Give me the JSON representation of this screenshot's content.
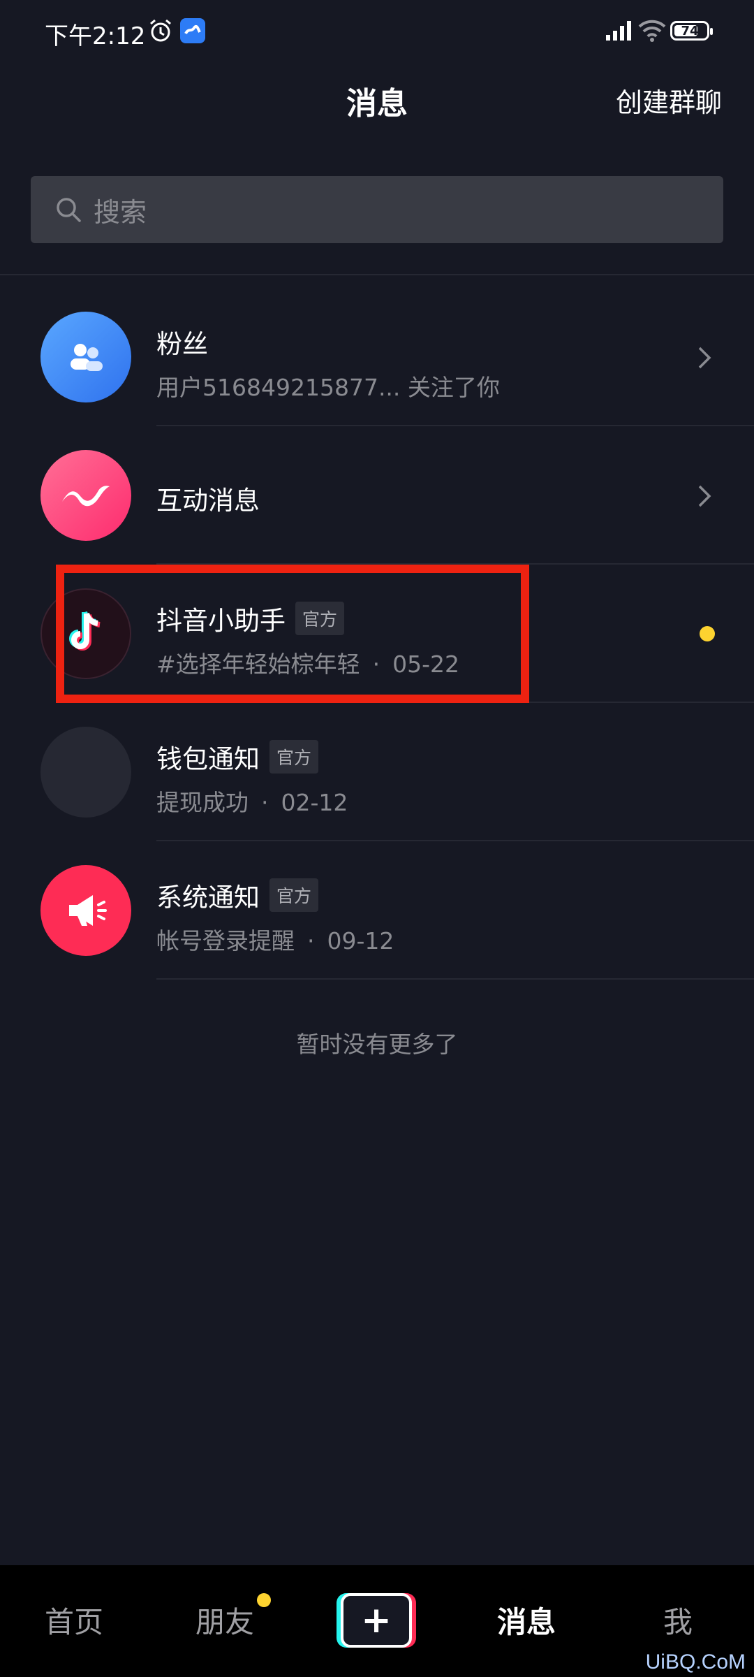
{
  "status_bar": {
    "time": "下午2:12",
    "battery": "74",
    "battery_fill_fraction": 0.74
  },
  "header": {
    "title": "消息",
    "create_group": "创建群聊"
  },
  "search": {
    "placeholder": "搜索"
  },
  "messages": [
    {
      "title": "粉丝",
      "subtitle": "用户516849215877... 关注了你",
      "icon": "fans-icon",
      "color": "#3d8bf5",
      "has_chevron": true
    },
    {
      "title": "互动消息",
      "icon": "interaction-icon",
      "color": "#fe3c72",
      "has_chevron": true
    },
    {
      "title": "抖音小助手",
      "badge": "官方",
      "subtitle": "#选择年轻始棕年轻",
      "date": "05-22",
      "icon": "douyin-logo-icon",
      "unread": true
    },
    {
      "title": "钱包通知",
      "badge": "官方",
      "subtitle": "提现成功",
      "date": "02-12",
      "icon": "wallet-icon"
    },
    {
      "title": "系统通知",
      "badge": "官方",
      "subtitle": "帐号登录提醒",
      "date": "09-12",
      "icon": "megaphone-icon",
      "color": "#fe2c55"
    }
  ],
  "dot_separator": "·",
  "footer_text": "暂时没有更多了",
  "bottom_nav": {
    "home": "首页",
    "friends": "朋友",
    "plus": "+",
    "messages": "消息",
    "me": "我"
  },
  "watermark": "UiBQ.CoM"
}
